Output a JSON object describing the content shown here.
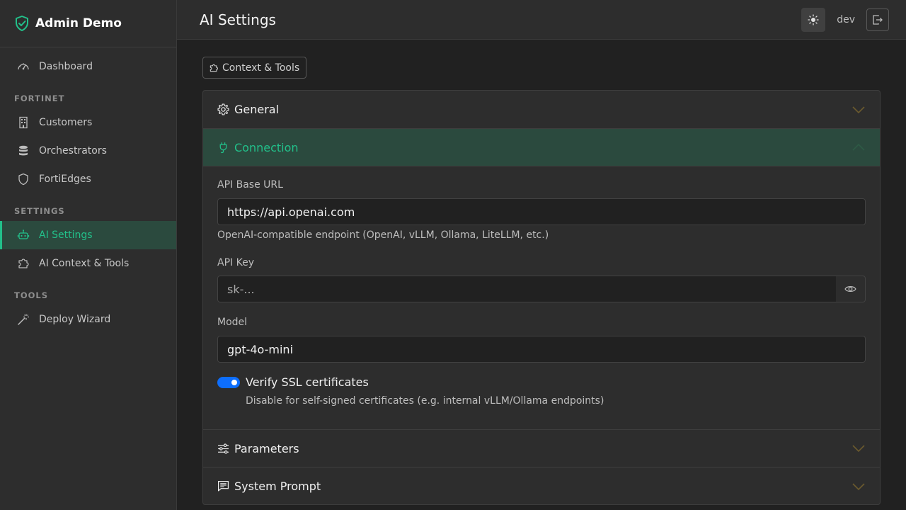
{
  "app": {
    "title": "Admin Demo",
    "icon": "shield-check-icon"
  },
  "sidebar": {
    "top_items": [
      {
        "label": "Dashboard",
        "icon": "speedometer-icon"
      }
    ],
    "sections": [
      {
        "title": "FORTINET",
        "items": [
          {
            "label": "Customers",
            "icon": "building-icon"
          },
          {
            "label": "Orchestrators",
            "icon": "database-icon"
          },
          {
            "label": "FortiEdges",
            "icon": "shield-icon"
          }
        ]
      },
      {
        "title": "SETTINGS",
        "items": [
          {
            "label": "AI Settings",
            "icon": "robot-icon",
            "active": true
          },
          {
            "label": "AI Context & Tools",
            "icon": "puzzle-icon"
          }
        ]
      },
      {
        "title": "TOOLS",
        "items": [
          {
            "label": "Deploy Wizard",
            "icon": "magic-wand-icon"
          }
        ]
      }
    ]
  },
  "header": {
    "title": "AI Settings",
    "theme_icon": "sun-icon",
    "user": "dev",
    "logout_icon": "logout-icon"
  },
  "context_button": {
    "label": "Context & Tools",
    "icon": "puzzle-icon"
  },
  "accordion": {
    "general": {
      "label": "General",
      "icon": "gear-icon",
      "expanded": false
    },
    "connection": {
      "label": "Connection",
      "icon": "plug-icon",
      "expanded": true,
      "api_base_url": {
        "label": "API Base URL",
        "value": "https://api.openai.com",
        "help": "OpenAI-compatible endpoint (OpenAI, vLLM, Ollama, LiteLLM, etc.)"
      },
      "api_key": {
        "label": "API Key",
        "placeholder": "sk-...",
        "reveal_icon": "eye-icon"
      },
      "model": {
        "label": "Model",
        "value": "gpt-4o-mini"
      },
      "verify_ssl": {
        "label": "Verify SSL certificates",
        "help": "Disable for self-signed certificates (e.g. internal vLLM/Ollama endpoints)",
        "enabled": true
      }
    },
    "parameters": {
      "label": "Parameters",
      "icon": "sliders-icon",
      "expanded": false
    },
    "system_prompt": {
      "label": "System Prompt",
      "icon": "chat-icon",
      "expanded": false
    }
  },
  "colors": {
    "accent": "#22c08a",
    "toggle": "#0d6efd",
    "chevron": "#6b5a2e"
  }
}
